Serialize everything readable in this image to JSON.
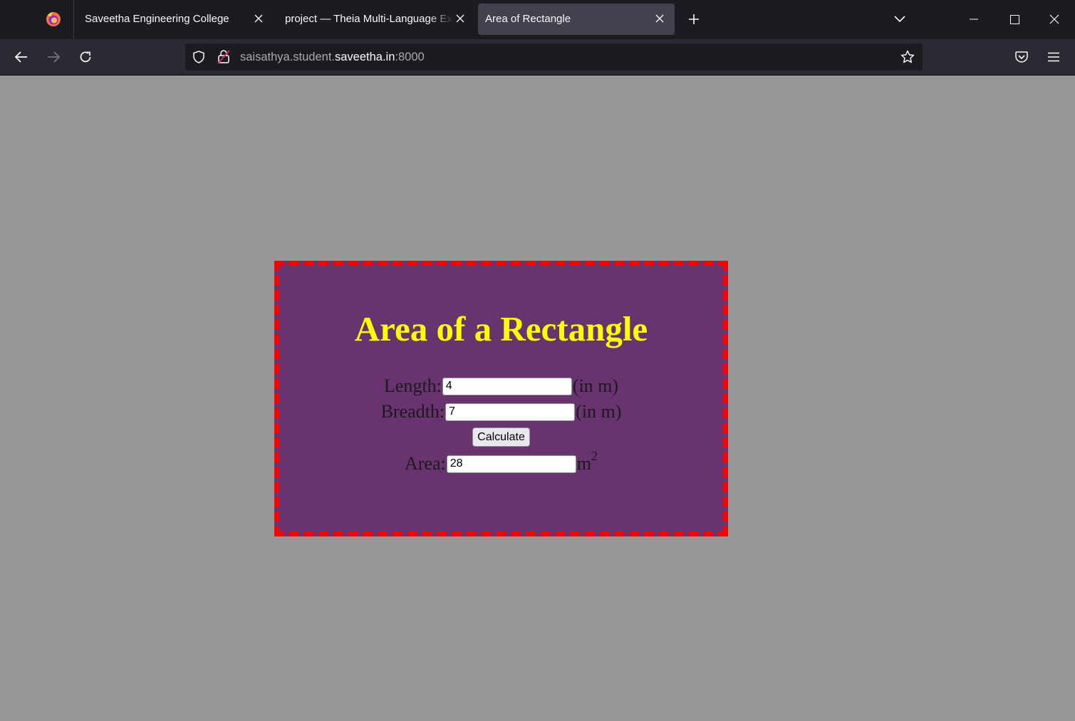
{
  "browser": {
    "tabs": [
      {
        "title": "Saveetha Engineering College",
        "active": false
      },
      {
        "title": "project — Theia Multi-Language Explorer",
        "active": false
      },
      {
        "title": "Area of Rectangle",
        "active": true
      }
    ],
    "url": {
      "prefix": "saisathya.student.",
      "host": "saveetha.in",
      "suffix": ":8000"
    },
    "colors": {
      "tabbar": "#1c1b22",
      "navbar": "#2b2a33",
      "active_tab": "#42414d"
    }
  },
  "page": {
    "background": "#979797",
    "heading": "Area of a Rectangle",
    "length_label": "Length:",
    "length_value": "4",
    "length_unit": "(in m)",
    "breadth_label": "Breadth:",
    "breadth_value": "7",
    "breadth_unit": "(in m)",
    "calculate_label": "Calculate",
    "area_label": "Area:",
    "area_value": "28",
    "area_unit": "m",
    "area_unit_exp": "2",
    "colors": {
      "card_bg": "#68336e",
      "card_border": "#ff0000",
      "heading": "#ffff00"
    }
  }
}
